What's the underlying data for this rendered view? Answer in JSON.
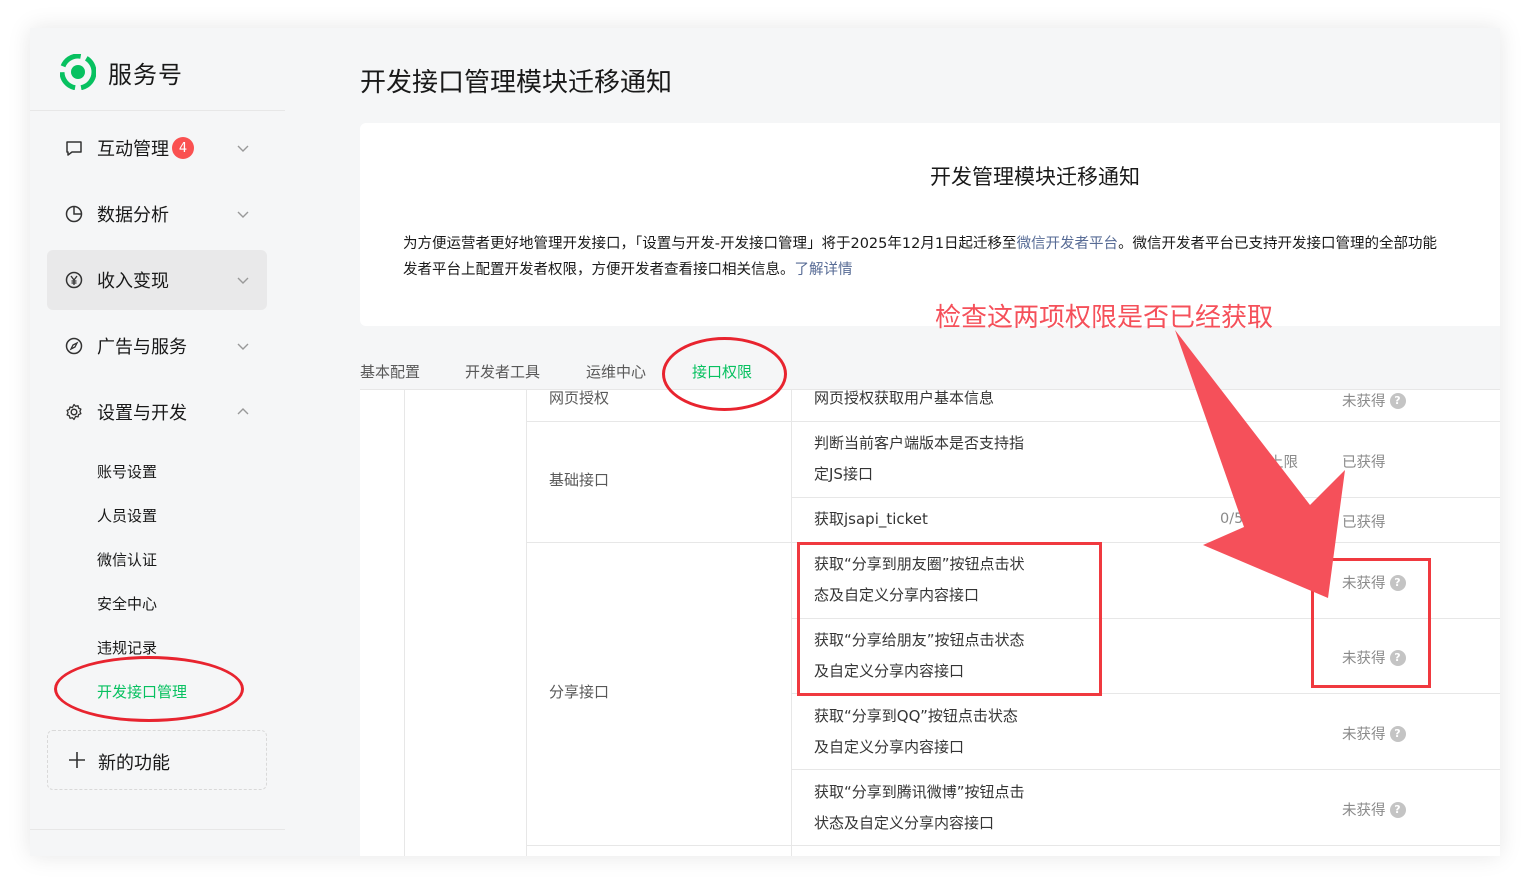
{
  "app": {
    "name": "服务号"
  },
  "sidebar": {
    "items": [
      {
        "label": "互动管理",
        "badge": "4",
        "icon": "chat-bubble-icon",
        "expanded": false
      },
      {
        "label": "数据分析",
        "icon": "pie-chart-icon",
        "expanded": false
      },
      {
        "label": "收入变现",
        "icon": "yen-coin-icon",
        "expanded": false,
        "active": true
      },
      {
        "label": "广告与服务",
        "icon": "compass-icon",
        "expanded": false
      },
      {
        "label": "设置与开发",
        "icon": "gear-icon",
        "expanded": true
      }
    ],
    "sub_items": [
      {
        "label": "账号设置"
      },
      {
        "label": "人员设置"
      },
      {
        "label": "微信认证"
      },
      {
        "label": "安全中心"
      },
      {
        "label": "违规记录"
      },
      {
        "label": "开发接口管理",
        "active": true
      }
    ],
    "new_function": "新的功能"
  },
  "page": {
    "title": "开发接口管理模块迁移通知"
  },
  "notice": {
    "title": "开发管理模块迁移通知",
    "line1_prefix": "为方便运营者更好地管理开发接口，「设置与开发-开发接口管理」将于2025年12月1日起迁移至",
    "line1_link": "微信开发者平台",
    "line1_suffix": "。微信开发者平台已支持开发接口管理的全部功能",
    "line2_prefix": "发者平台上配置开发者权限，方便开发者查看接口相关信息。",
    "line2_link": "了解详情"
  },
  "tabs": [
    {
      "label": "基本配置"
    },
    {
      "label": "开发者工具"
    },
    {
      "label": "运维中心"
    },
    {
      "label": "接口权限",
      "active": true
    }
  ],
  "table": {
    "groups": [
      {
        "name": "网页授权"
      },
      {
        "name": "基础接口"
      },
      {
        "name": "分享接口"
      }
    ],
    "rows": [
      {
        "api": "网页授权获取用户基本信息",
        "quota": "",
        "status": "未获得",
        "help": "?"
      },
      {
        "api_line1": "判断当前客户端版本是否支持指",
        "api_line2": "定JS接口",
        "quota": "上限",
        "status": "已获得"
      },
      {
        "api": "获取jsapi_ticket",
        "quota": "0/500",
        "status": "已获得"
      },
      {
        "api_line1": "获取“分享到朋友圈”按钮点击状",
        "api_line2": "态及自定义分享内容接口",
        "status": "未获得",
        "help": "?"
      },
      {
        "api_line1": "获取“分享给朋友”按钮点击状态",
        "api_line2": "及自定义分享内容接口",
        "status": "未获得",
        "help": "?"
      },
      {
        "api_line1": "获取“分享到QQ”按钮点击状态",
        "api_line2": "及自定义分享内容接口",
        "status": "未获得",
        "help": "?"
      },
      {
        "api_line1": "获取“分享到腾讯微博”按钮点击",
        "api_line2": "状态及自定义分享内容接口",
        "status": "未获得",
        "help": "?"
      }
    ]
  },
  "annotation": {
    "text": "检查这两项权限是否已经获取",
    "color": "#f5505a"
  },
  "colors": {
    "accent": "#07c160",
    "link": "#576b95",
    "badge": "#fa5151",
    "annotation": "#f0393f"
  }
}
